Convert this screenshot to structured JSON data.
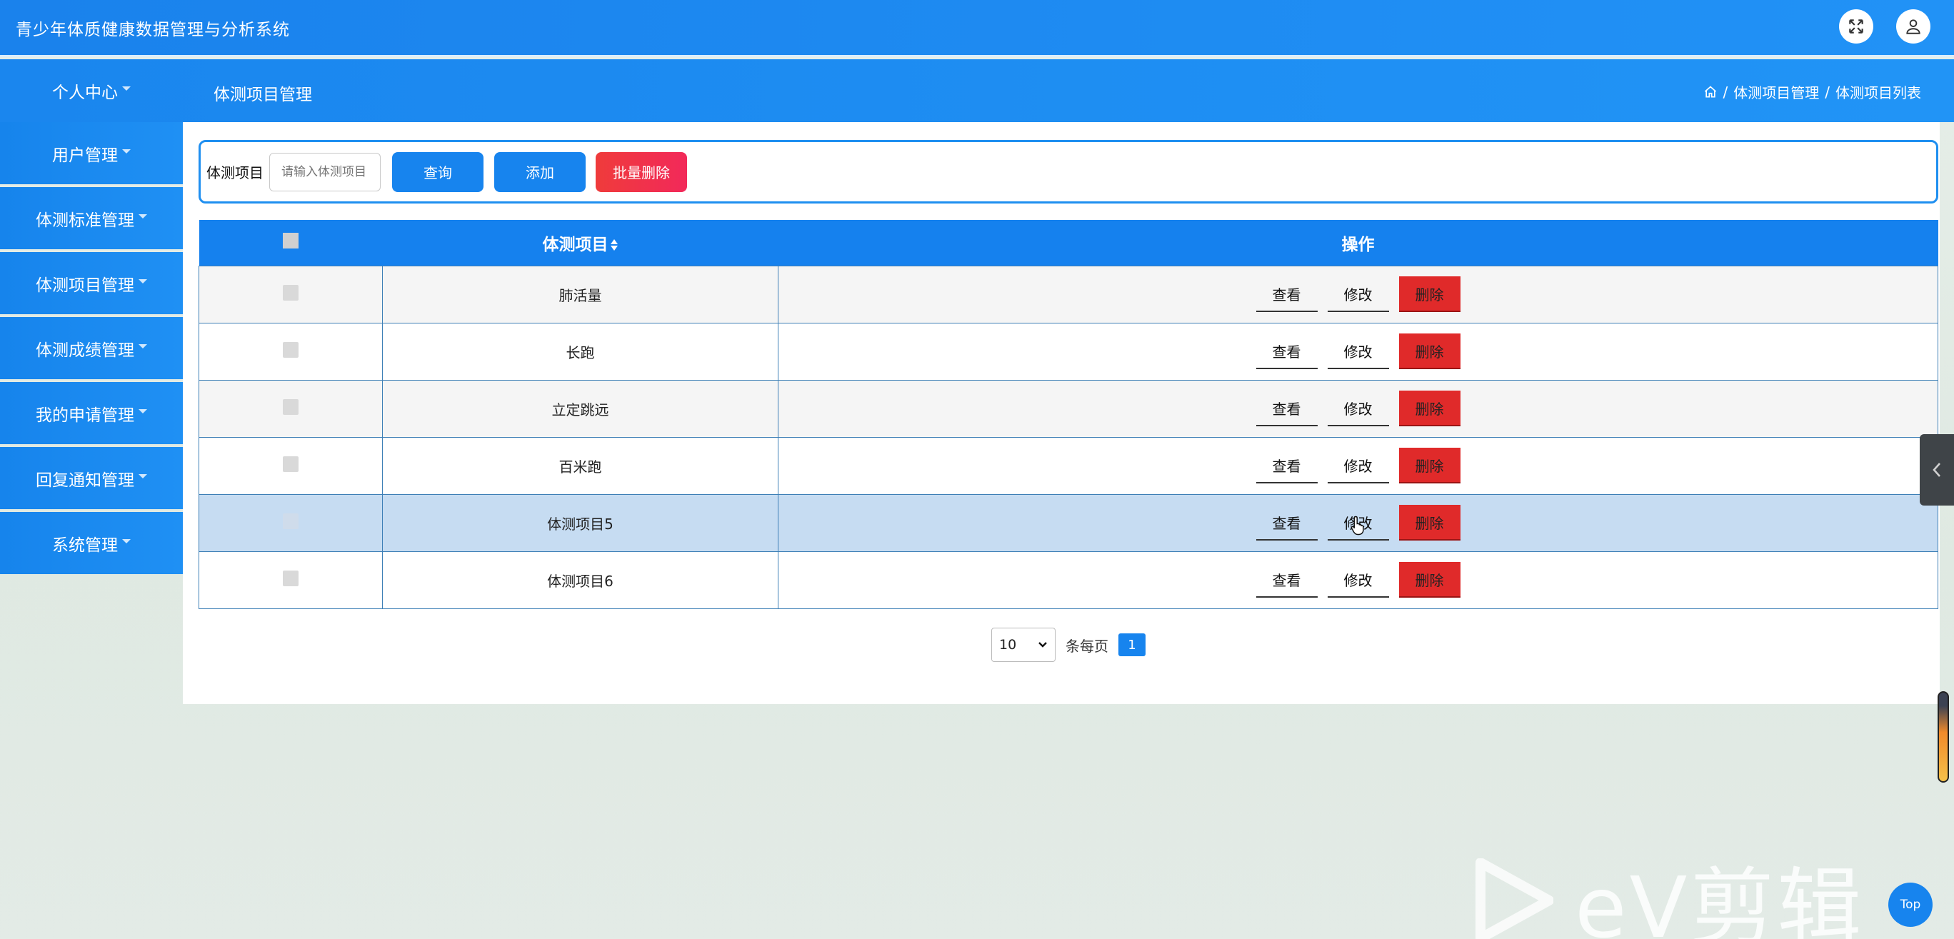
{
  "app": {
    "title": "青少年体质健康数据管理与分析系统"
  },
  "header": {
    "fullscreen_icon": "fullscreen-icon",
    "user_icon": "user-icon",
    "nav_top_label": "个人中心",
    "page_title": "体测项目管理",
    "breadcrumb": [
      "体测项目管理",
      "体测项目列表"
    ],
    "breadcrumb_sep": "/"
  },
  "sidebar": {
    "items": [
      {
        "label": "用户管理"
      },
      {
        "label": "体测标准管理"
      },
      {
        "label": "体测项目管理"
      },
      {
        "label": "体测成绩管理"
      },
      {
        "label": "我的申请管理"
      },
      {
        "label": "回复通知管理"
      },
      {
        "label": "系统管理"
      }
    ]
  },
  "search": {
    "label": "体测项目",
    "placeholder": "请输入体测项目",
    "query_button": "查询",
    "add_button": "添加",
    "batch_delete_button": "批量删除"
  },
  "table": {
    "headers": {
      "item": "体测项目",
      "actions": "操作"
    },
    "rows": [
      {
        "name": "肺活量"
      },
      {
        "name": "长跑"
      },
      {
        "name": "立定跳远"
      },
      {
        "name": "百米跑"
      },
      {
        "name": "体测项目5"
      },
      {
        "name": "体测项目6"
      }
    ],
    "actions": {
      "view": "查看",
      "edit": "修改",
      "delete": "删除"
    }
  },
  "pagination": {
    "page_size": "10",
    "per_page_label": "条每页",
    "current_page": "1"
  },
  "widgets": {
    "top_button": "Top",
    "watermark": "eV剪辑"
  },
  "colors": {
    "primary": "#1784ee",
    "danger": "#e02a2a",
    "hover_row": "#c6dcf2"
  }
}
